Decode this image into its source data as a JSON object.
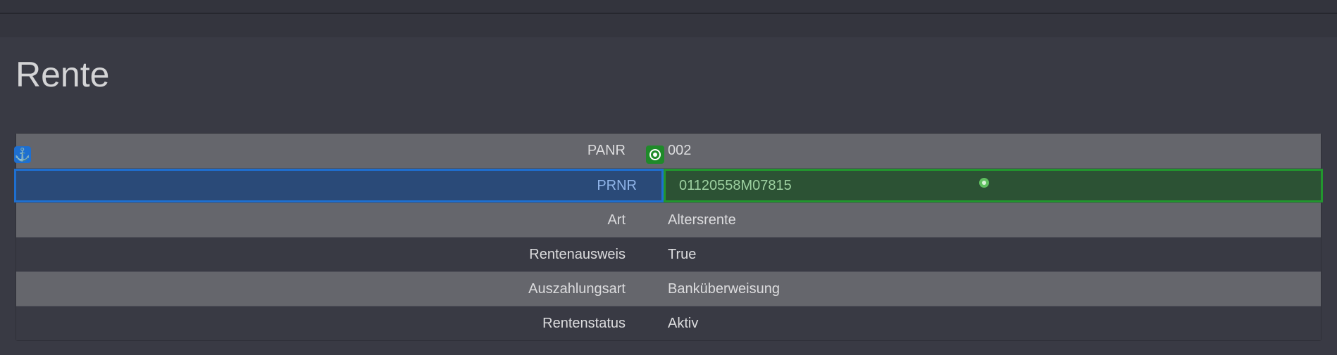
{
  "page": {
    "title": "Rente"
  },
  "table": {
    "rows": [
      {
        "label": "PANR",
        "value": "002"
      },
      {
        "label": "PRNR",
        "value": "01120558M07815"
      },
      {
        "label": "Art",
        "value": "Altersrente"
      },
      {
        "label": "Rentenausweis",
        "value": "True"
      },
      {
        "label": "Auszahlungsart",
        "value": "Banküberweisung"
      },
      {
        "label": "Rentenstatus",
        "value": "Aktiv"
      }
    ]
  },
  "overlay": {
    "anchor_icon": "anchor-icon",
    "target_icon": "target-icon",
    "anchor_glyph": "⚓",
    "colors": {
      "anchor": "#1e6fd0",
      "target": "#22962e"
    }
  }
}
